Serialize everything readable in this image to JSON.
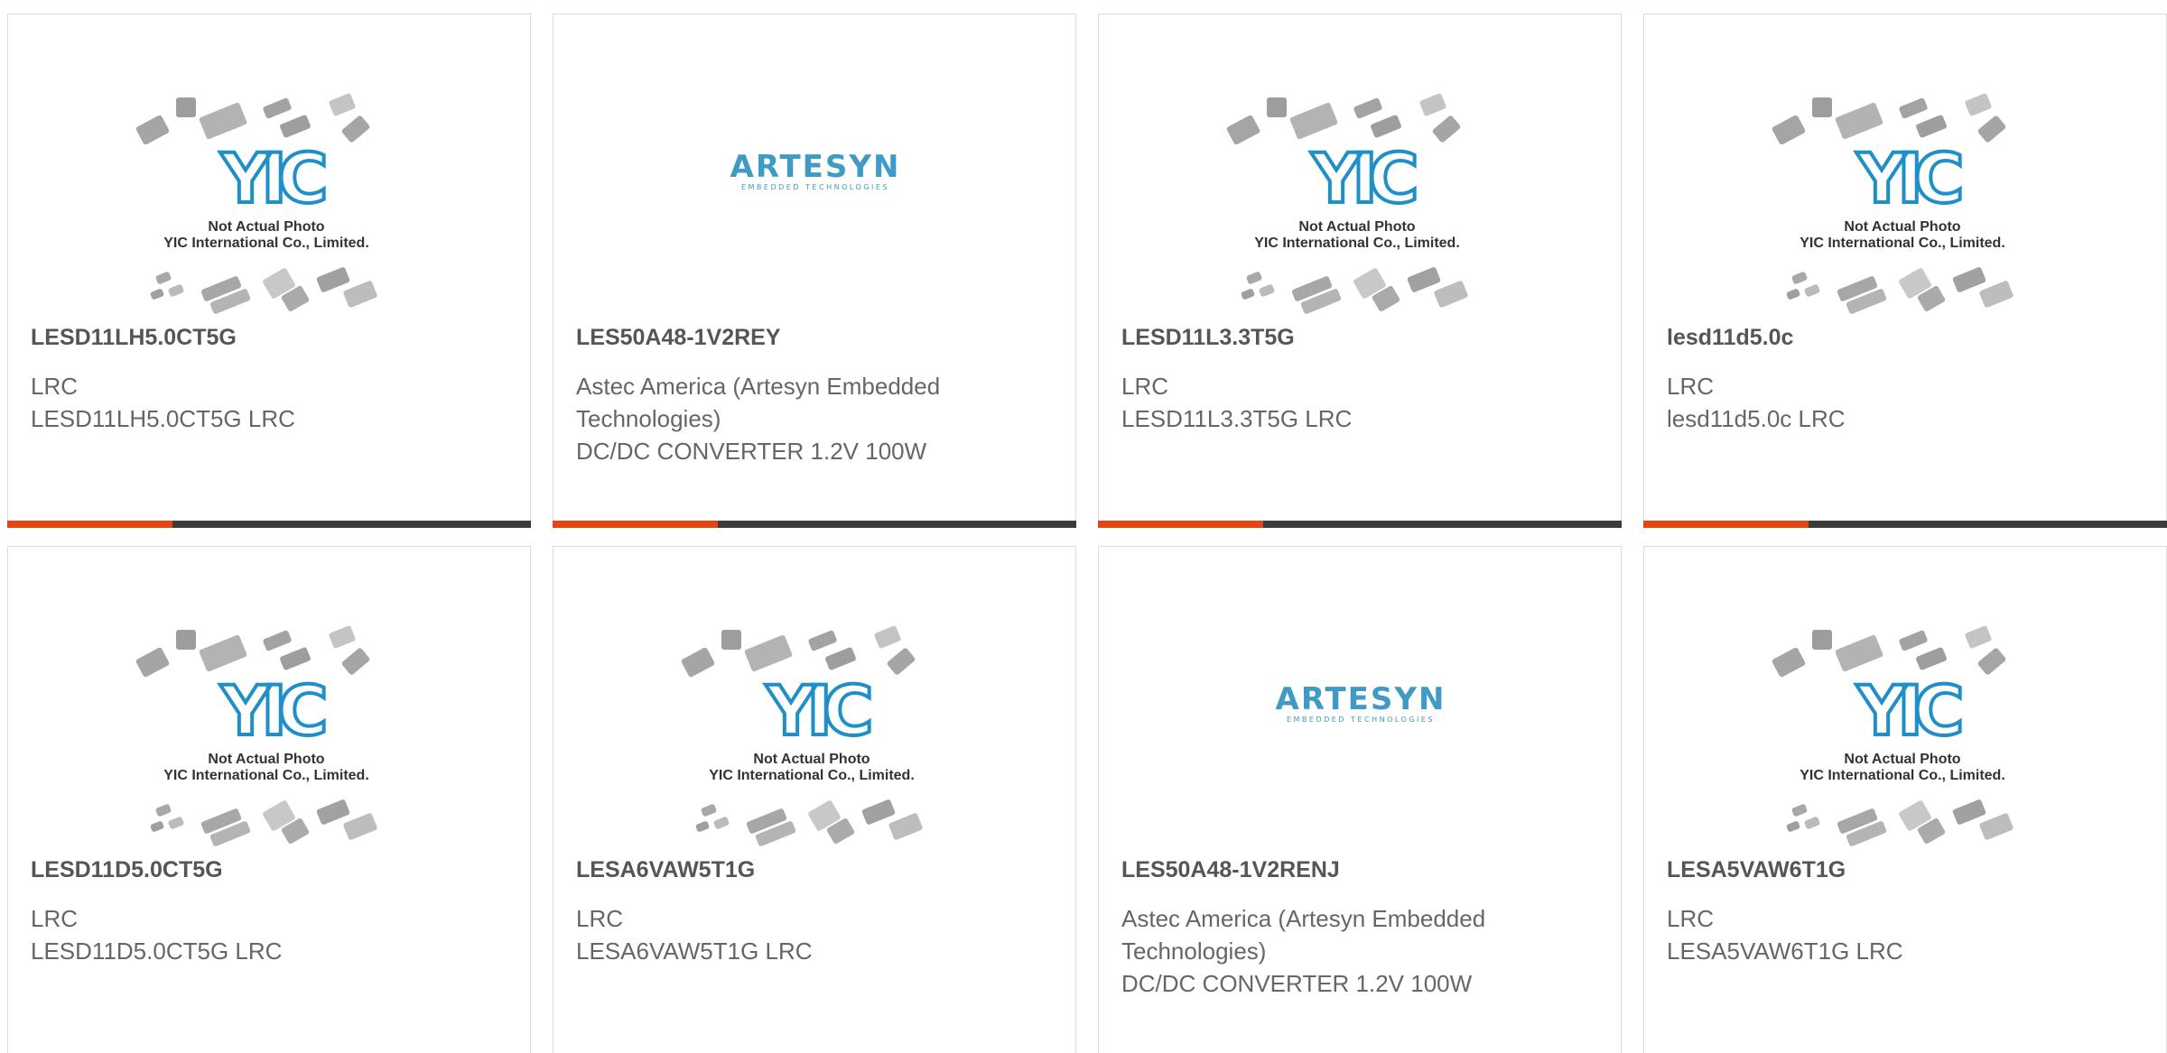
{
  "products": [
    {
      "part": "LESD11LH5.0CT5G",
      "manufacturer": "LRC",
      "description": "LESD11LH5.0CT5G LRC",
      "image": "yic-placeholder"
    },
    {
      "part": "LES50A48-1V2REY",
      "manufacturer": "Astec America (Artesyn Embedded Technologies)",
      "description": "DC/DC CONVERTER 1.2V 100W",
      "image": "artesyn-logo"
    },
    {
      "part": "LESD11L3.3T5G",
      "manufacturer": "LRC",
      "description": "LESD11L3.3T5G LRC",
      "image": "yic-placeholder"
    },
    {
      "part": "lesd11d5.0c",
      "manufacturer": "LRC",
      "description": "lesd11d5.0c LRC",
      "image": "yic-placeholder"
    },
    {
      "part": "LESD11D5.0CT5G",
      "manufacturer": "LRC",
      "description": "LESD11D5.0CT5G LRC",
      "image": "yic-placeholder"
    },
    {
      "part": "LESA6VAW5T1G",
      "manufacturer": "LRC",
      "description": "LESA6VAW5T1G LRC",
      "image": "yic-placeholder"
    },
    {
      "part": "LES50A48-1V2RENJ",
      "manufacturer": "Astec America (Artesyn Embedded Technologies)",
      "description": "DC/DC CONVERTER 1.2V 100W",
      "image": "artesyn-logo"
    },
    {
      "part": "LESA5VAW6T1G",
      "manufacturer": "LRC",
      "description": "LESA5VAW6T1G LRC",
      "image": "yic-placeholder"
    }
  ],
  "placeholder": {
    "logo_text": "YIC",
    "caption_line1": "Not Actual Photo",
    "caption_line2": "YIC International Co., Limited."
  },
  "artesyn": {
    "logo_text": "ARTESYN",
    "tagline": "EMBEDDED TECHNOLOGIES"
  },
  "colors": {
    "accent_bar": "#e84412",
    "dark_bar": "#3b3b3b",
    "yic_blue": "#1f8fc8",
    "artesyn_blue": "#3f9ac4"
  }
}
